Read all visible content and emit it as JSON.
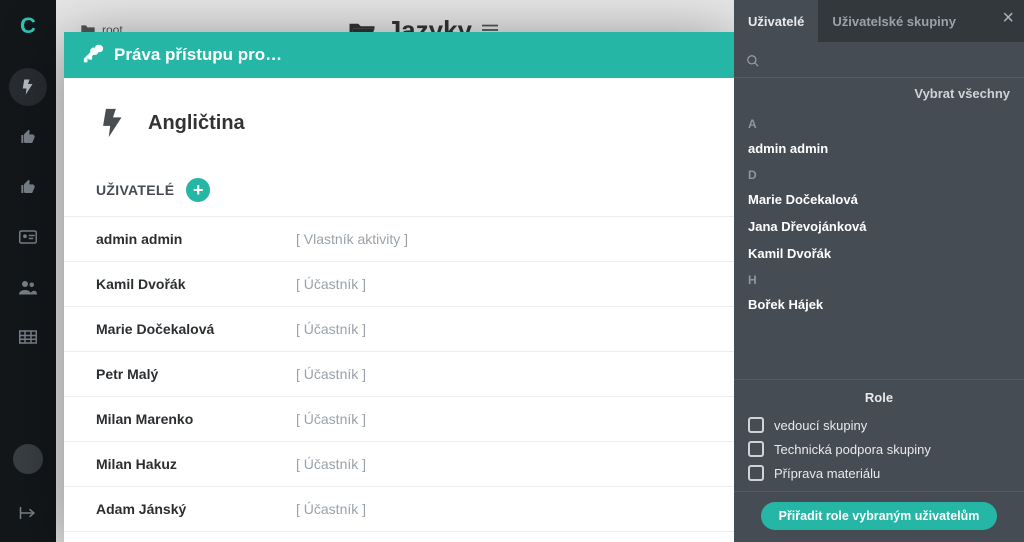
{
  "leftnav": {
    "logo": "C"
  },
  "background": {
    "breadcrumb": "root",
    "folder_title": "Jazyky"
  },
  "modal": {
    "title": "Práva přístupu pro…",
    "activity_name": "Angličtina",
    "section_label": "UŽIVATELÉ",
    "users": [
      {
        "name": "admin admin",
        "role": "[ Vlastník aktivity ]"
      },
      {
        "name": "Kamil Dvořák",
        "role": "[ Účastník ]"
      },
      {
        "name": "Marie Dočekalová",
        "role": "[ Účastník ]"
      },
      {
        "name": "Petr Malý",
        "role": "[ Účastník ]"
      },
      {
        "name": "Milan Marenko",
        "role": "[ Účastník ]"
      },
      {
        "name": "Milan Hakuz",
        "role": "[ Účastník ]"
      },
      {
        "name": "Adam Jánský",
        "role": "[ Účastník ]"
      }
    ]
  },
  "sidepanel": {
    "tabs": {
      "users": "Uživatelé",
      "groups": "Uživatelské skupiny"
    },
    "search_placeholder": "",
    "select_all": "Vybrat všechny",
    "groups": [
      {
        "letter": "A",
        "users": [
          "admin admin"
        ]
      },
      {
        "letter": "D",
        "users": [
          "Marie Dočekalová",
          "Jana Dřevojánková",
          "Kamil Dvořák"
        ]
      },
      {
        "letter": "H",
        "users": [
          "Bořek Hájek"
        ]
      }
    ],
    "roles_title": "Role",
    "roles": [
      "vedoucí skupiny",
      "Technická podpora skupiny",
      "Příprava materiálu"
    ],
    "assign_button": "Přiřadit role vybraným uživatelům"
  }
}
